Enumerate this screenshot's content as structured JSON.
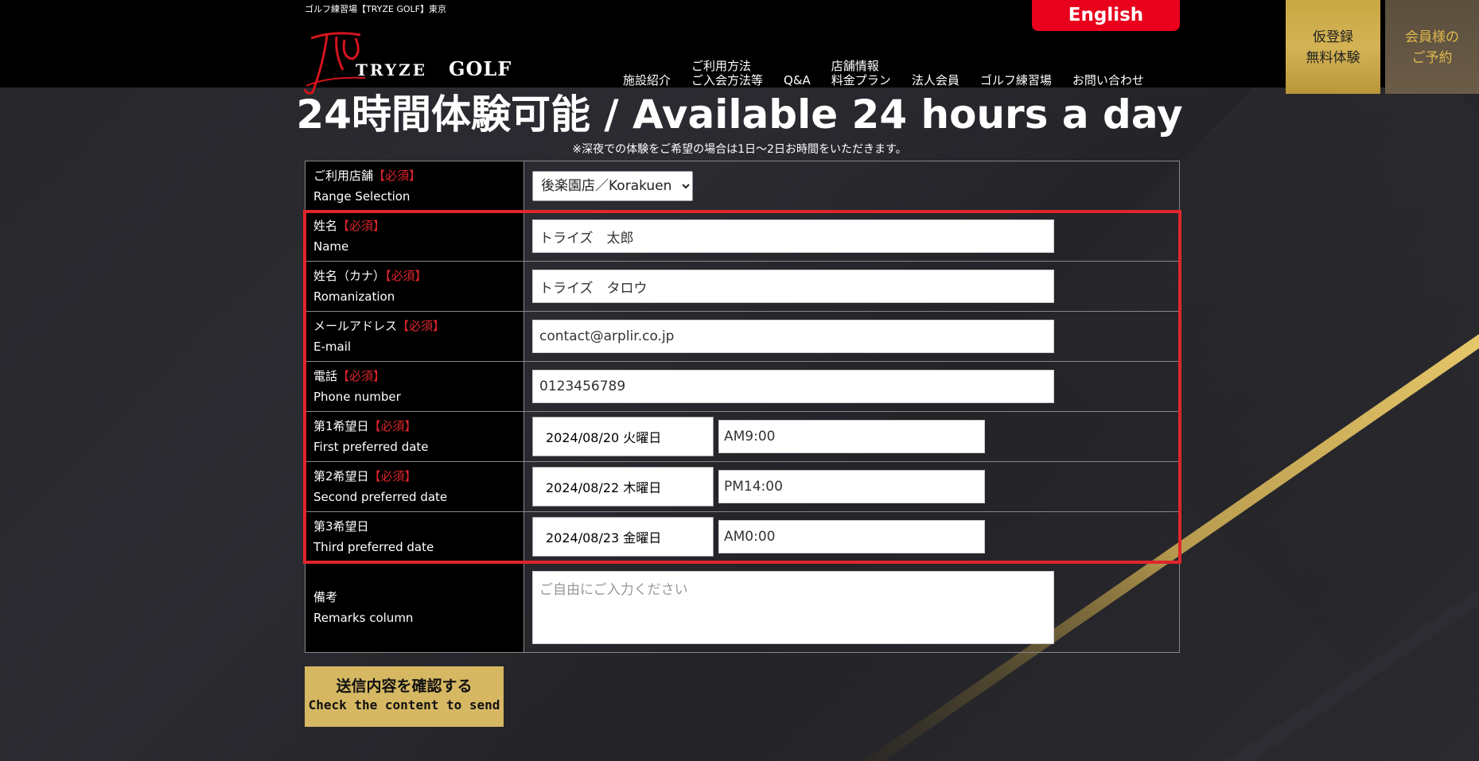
{
  "header": {
    "tagline": "ゴルフ練習場【TRYZE GOLF】東京",
    "logo_word": "TRYZE",
    "logo_golf": "GOLF",
    "nav": [
      {
        "line1": "施設紹介",
        "line2": ""
      },
      {
        "line1": "ご利用方法",
        "line2": "ご入会方法等"
      },
      {
        "line1": "Q&A",
        "line2": ""
      },
      {
        "line1": "店舗情報",
        "line2": "料金プラン"
      },
      {
        "line1": "法人会員",
        "line2": ""
      },
      {
        "line1": "ゴルフ練習場",
        "line2": ""
      },
      {
        "line1": "お問い合わせ",
        "line2": ""
      }
    ],
    "english_label": "English",
    "trial_line1": "仮登録",
    "trial_line2": "無料体験",
    "member_line1": "会員様の",
    "member_line2": "ご予約"
  },
  "title": "24時間体験可能 / Available 24 hours a day",
  "note": "※深夜での体験をご希望の場合は1日〜2日お時間をいただきます。",
  "form": {
    "required_mark": "【必須】",
    "store": {
      "label_jp": "ご利用店舗",
      "label_en": "Range Selection",
      "value": "後楽園店／Korakuen"
    },
    "name": {
      "label_jp": "姓名",
      "label_en": "Name",
      "value": "トライズ　太郎"
    },
    "kana": {
      "label_jp": "姓名（カナ）",
      "label_en": "Romanization",
      "value": "トライズ　タロウ"
    },
    "email": {
      "label_jp": "メールアドレス",
      "label_en": "E-mail",
      "value": "contact@arplir.co.jp"
    },
    "phone": {
      "label_jp": "電話",
      "label_en": "Phone number",
      "value": "0123456789"
    },
    "date1": {
      "label_jp": "第1希望日",
      "label_en": "First preferred date",
      "date": "2024/08/20 火曜日",
      "time": "AM9:00"
    },
    "date2": {
      "label_jp": "第2希望日",
      "label_en": "Second preferred date",
      "date": "2024/08/22 木曜日",
      "time": "PM14:00"
    },
    "date3": {
      "label_jp": "第3希望日",
      "label_en": "Third preferred date",
      "date": "2024/08/23 金曜日",
      "time": "AM0:00"
    },
    "remarks": {
      "label_jp": "備考",
      "label_en": "Remarks column",
      "placeholder": "ご自由にご入力ください"
    }
  },
  "submit": {
    "jp": "送信内容を確認する",
    "en": "Check the content to send"
  },
  "colors": {
    "accent_red": "#e0252c",
    "gold": "#d6b863",
    "english_red": "#e8001c"
  }
}
